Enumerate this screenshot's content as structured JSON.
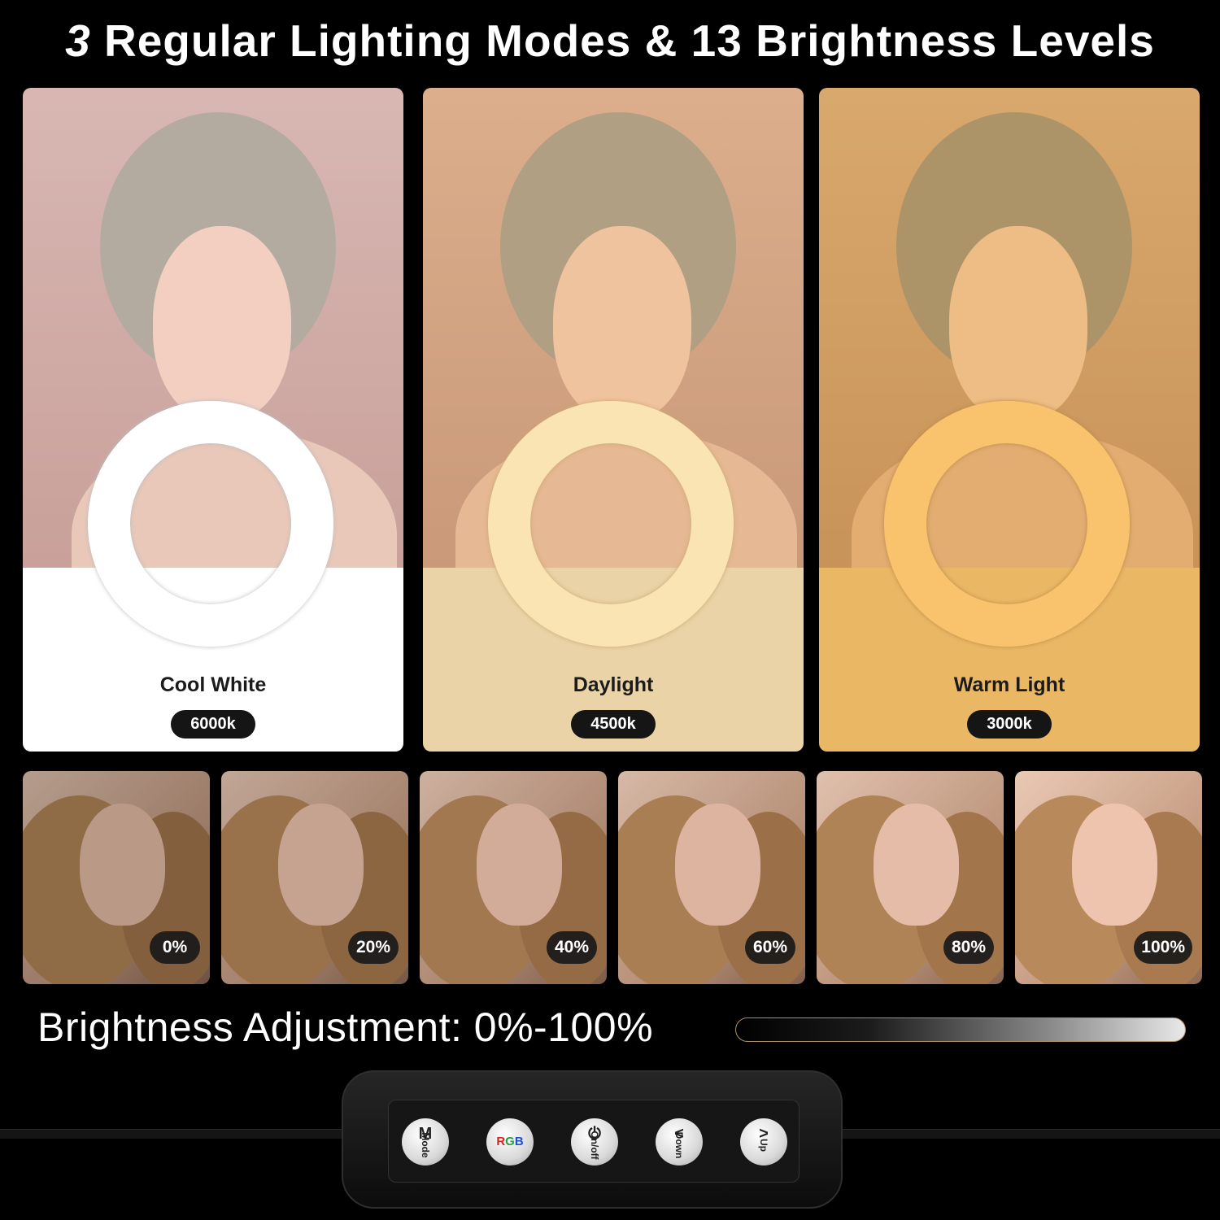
{
  "headline": {
    "number": "3",
    "text": " Regular Lighting Modes & 13 Brightness Levels"
  },
  "modes": [
    {
      "label": "Cool White",
      "temperature": "6000k",
      "accent": "#ffffff",
      "photo_tint": "#d9b3ad"
    },
    {
      "label": "Daylight",
      "temperature": "4500k",
      "accent": "#ead3a7",
      "photo_tint": "#d9ab88"
    },
    {
      "label": "Warm Light",
      "temperature": "3000k",
      "accent": "#eab865",
      "photo_tint": "#d6a46a"
    }
  ],
  "brightness_levels": [
    "0%",
    "20%",
    "40%",
    "60%",
    "80%",
    "100%"
  ],
  "brightness_fill": [
    0,
    0.2,
    0.4,
    0.6,
    0.8,
    1.0
  ],
  "brightness_caption": "Brightness Adjustment: 0%-100%",
  "controller": {
    "mode": {
      "glyph": "M",
      "label": "Mode"
    },
    "rgb": {
      "r": "R",
      "g": "G",
      "b": "B"
    },
    "power": {
      "glyph": "⏻",
      "label": "On/off"
    },
    "down": {
      "glyph": "<",
      "label": "Down"
    },
    "up": {
      "glyph": ">",
      "label": "Up"
    }
  }
}
